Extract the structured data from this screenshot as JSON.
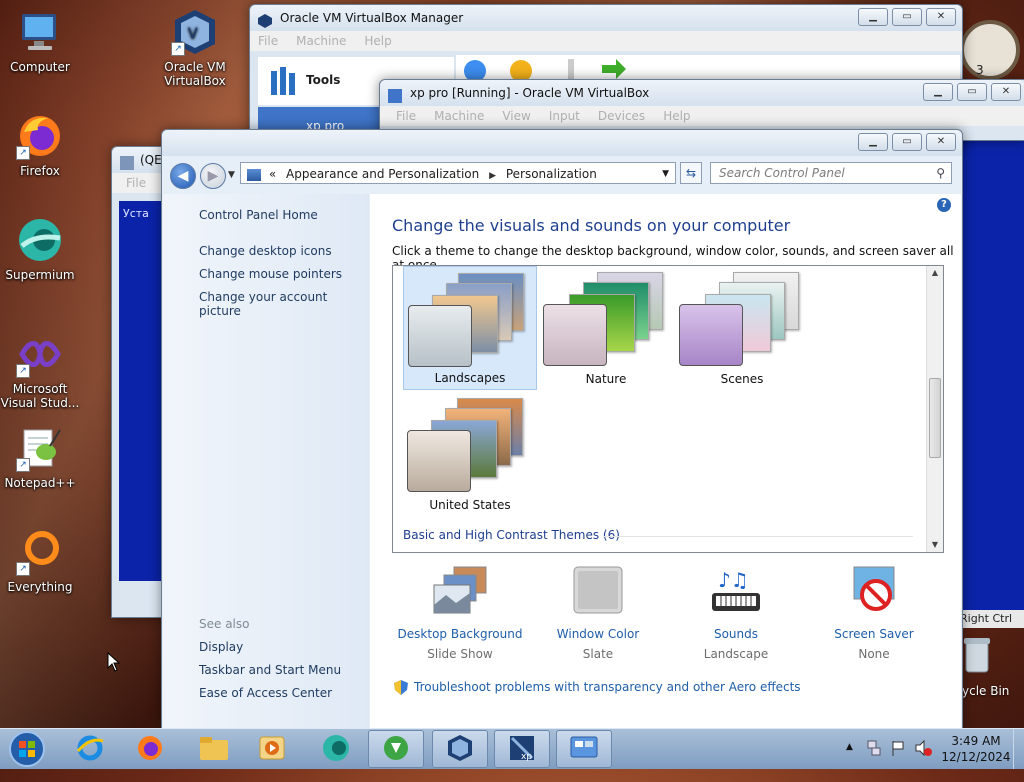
{
  "desktop": {
    "icons": [
      {
        "name": "computer-icon",
        "label": "Computer"
      },
      {
        "name": "virtualbox-icon",
        "label": "Oracle VM VirtualBox"
      },
      {
        "name": "firefox-icon",
        "label": "Firefox"
      },
      {
        "name": "supermium-icon",
        "label": "Supermium"
      },
      {
        "name": "visual-studio-icon",
        "label": "Microsoft Visual Stud..."
      },
      {
        "name": "notepadpp-icon",
        "label": "Notepad++"
      },
      {
        "name": "everything-icon",
        "label": "Everything"
      }
    ],
    "partial_right": {
      "right_ctrl": "Right Ctrl",
      "recycle_bin": "ycle Bin"
    }
  },
  "vbox_manager": {
    "title": "Oracle VM VirtualBox Manager",
    "menu": [
      "File",
      "Machine",
      "Help"
    ],
    "tools_label": "Tools",
    "vm_item": "xp pro"
  },
  "vm_window": {
    "title": "xp pro [Running] - Oracle VM VirtualBox",
    "menu": [
      "File",
      "Machine",
      "View",
      "Input",
      "Devices",
      "Help"
    ]
  },
  "qemu_window": {
    "title": "(QE",
    "menu": "File",
    "guest_text": "Уста"
  },
  "control_panel": {
    "address": {
      "prefix": "«",
      "crumbs": [
        "Appearance and Personalization",
        "Personalization"
      ]
    },
    "search_placeholder": "Search Control Panel",
    "left": {
      "home": "Control Panel Home",
      "links": [
        "Change desktop icons",
        "Change mouse pointers",
        "Change your account picture"
      ],
      "see_also_label": "See also",
      "see_also": [
        "Display",
        "Taskbar and Start Menu",
        "Ease of Access Center"
      ]
    },
    "heading": "Change the visuals and sounds on your computer",
    "subheading": "Click a theme to change the desktop background, window color, sounds, and screen saver all at once.",
    "themes": [
      "Landscapes",
      "Nature",
      "Scenes",
      "United States"
    ],
    "basic_themes": "Basic and High Contrast Themes (6)",
    "settings": [
      {
        "label": "Desktop Background",
        "value": "Slide Show"
      },
      {
        "label": "Window Color",
        "value": "Slate"
      },
      {
        "label": "Sounds",
        "value": "Landscape"
      },
      {
        "label": "Screen Saver",
        "value": "None"
      }
    ],
    "troubleshoot": "Troubleshoot problems with transparency and other Aero effects"
  },
  "taskbar": {
    "apps": [
      "start-button",
      "internet-explorer",
      "firefox",
      "file-explorer",
      "media-player",
      "supermium",
      "idm",
      "virtualbox",
      "xp-vm",
      "control-panel"
    ],
    "time": "3:49 AM",
    "date": "12/12/2024"
  },
  "colors": {
    "accent": "#1f5ea8",
    "heading": "#1f3f8e",
    "taskbar": "#8fabcc",
    "vm_blue": "#0b23a8"
  }
}
